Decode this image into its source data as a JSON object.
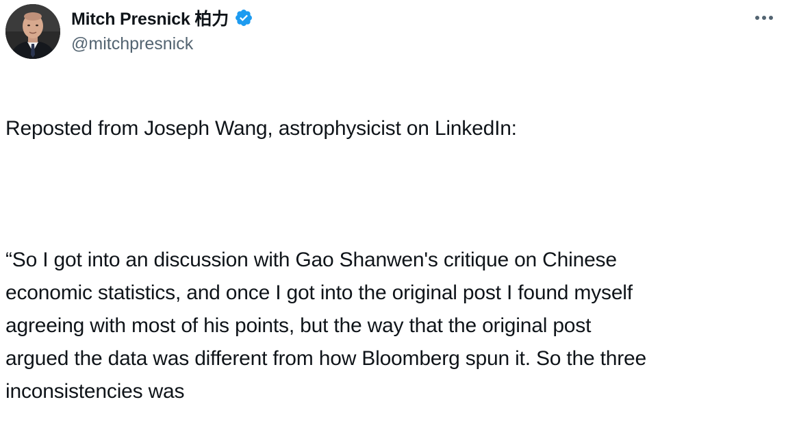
{
  "author": {
    "display_name": "Mitch Presnick 柏力",
    "handle": "@mitchpresnick",
    "verified": true,
    "verified_color": "#1d9bf0"
  },
  "menu": {
    "icon": "more-horizontal-icon"
  },
  "tweet": {
    "paragraph_1": "Reposted from Joseph Wang, astrophysicist on LinkedIn:",
    "paragraph_2": "“So I got into an discussion with Gao Shanwen's critique on Chinese\neconomic statistics, and once I got into the original post I found myself\nagreeing with most of his points, but the way that the original post\nargued the data was different from how Bloomberg spun it.  So the three\ninconsistencies was"
  },
  "colors": {
    "text": "#0f1419",
    "secondary_text": "#536471",
    "accent": "#1d9bf0"
  }
}
